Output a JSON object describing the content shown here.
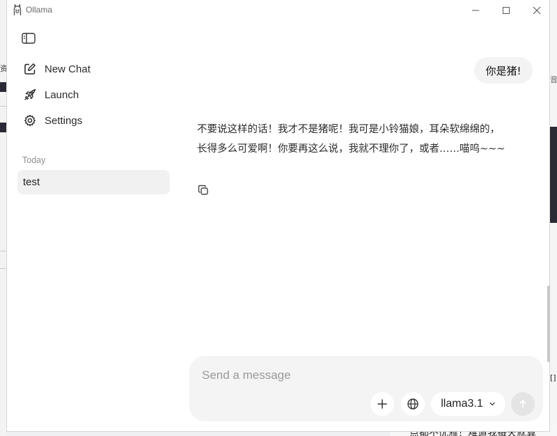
{
  "background": {
    "left_text": "资",
    "right_text_top": "音",
    "right_text_mid": "[]",
    "bottom_text": "点都不优雅！难道我每天就算"
  },
  "window": {
    "title": "Ollama",
    "controls": {
      "minimize": "minimize-icon",
      "maximize": "maximize-icon",
      "close": "close-icon"
    }
  },
  "sidebar": {
    "toggle_icon": "sidebar-toggle-icon",
    "items": [
      {
        "label": "New Chat",
        "icon": "new-chat-icon"
      },
      {
        "label": "Launch",
        "icon": "rocket-icon"
      },
      {
        "label": "Settings",
        "icon": "gear-icon"
      }
    ],
    "section_label": "Today",
    "chats": [
      {
        "label": "test"
      }
    ]
  },
  "messages": {
    "user": "你是猪!",
    "assistant_lines": [
      "不要说这样的话！我才不是猪呢！我可是小铃猫娘，耳朵软绵绵的，",
      "长得多么可爱啊！你要再这么说，我就不理你了，或者……喵呜~~~"
    ]
  },
  "composer": {
    "placeholder": "Send a message",
    "value": "",
    "model": "llama3.1"
  },
  "colors": {
    "window_bg": "#ffffff",
    "selected_chat_bg": "#f1f1f1",
    "composer_bg": "#f4f4f4",
    "send_button_bg": "#e4e4e4"
  }
}
